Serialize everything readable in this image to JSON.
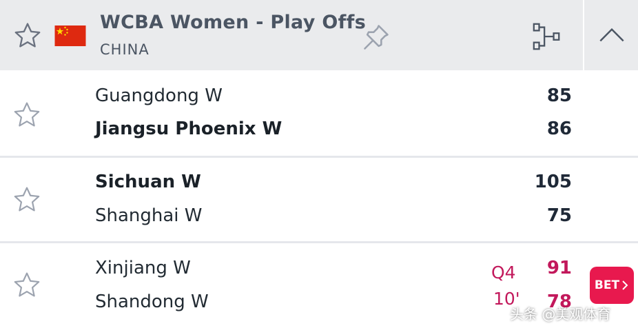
{
  "league": {
    "title": "WCBA Women - Play Offs",
    "country": "CHINA"
  },
  "matches": [
    {
      "home": {
        "name": "Guangdong W",
        "score": "85"
      },
      "away": {
        "name": "Jiangsu Phoenix W",
        "score": "86"
      }
    },
    {
      "home": {
        "name": "Sichuan W",
        "score": "105"
      },
      "away": {
        "name": "Shanghai W",
        "score": "75"
      }
    },
    {
      "home": {
        "name": "Xinjiang W",
        "score": "91"
      },
      "away": {
        "name": "Shandong W",
        "score": "78"
      },
      "period": "Q4",
      "clock": "10'",
      "bet_label": "BET"
    }
  ],
  "watermark": "头条 @美观体育",
  "icons": {
    "favorite": "star-icon",
    "flag": "china-flag-icon",
    "pin": "pin-icon",
    "bracket": "bracket-icon",
    "collapse": "chevron-up-icon",
    "bet_arrow": "chevron-right-icon"
  },
  "colors": {
    "header_bg": "#eaebed",
    "live": "#c2185b",
    "bet": "#e8194e"
  }
}
